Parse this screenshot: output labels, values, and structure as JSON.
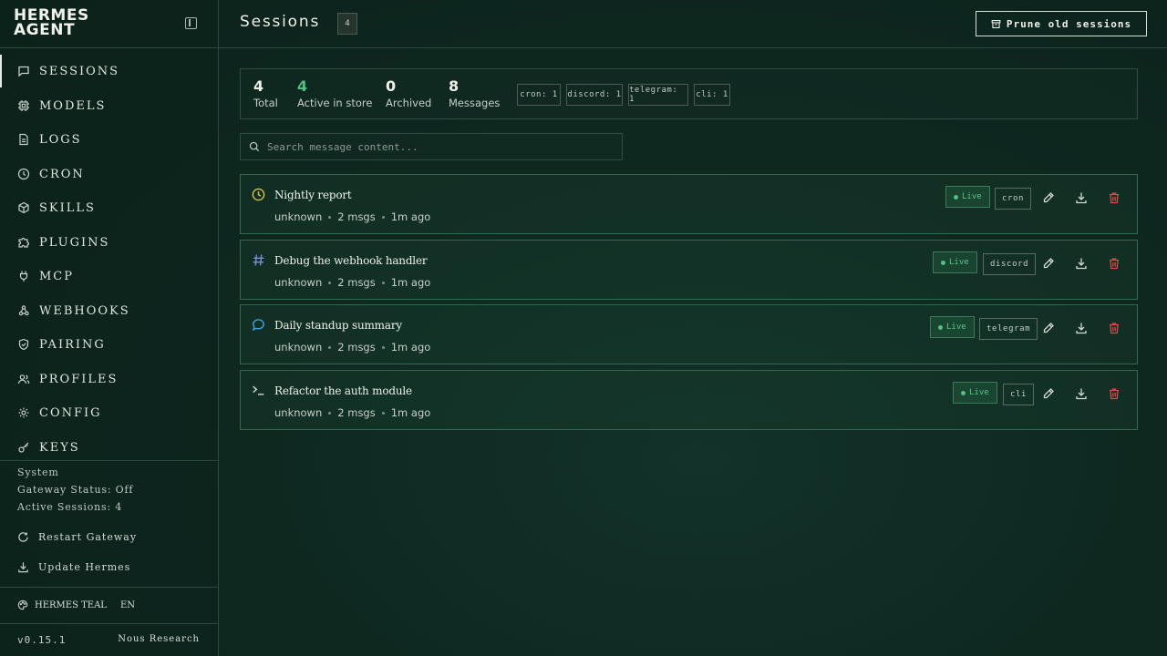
{
  "brand": {
    "line1": "HERMES",
    "line2": "AGENT"
  },
  "nav": [
    {
      "label": "SESSIONS",
      "icon": "chat-icon",
      "active": true
    },
    {
      "label": "MODELS",
      "icon": "cpu-icon"
    },
    {
      "label": "LOGS",
      "icon": "file-text-icon"
    },
    {
      "label": "CRON",
      "icon": "clock-icon"
    },
    {
      "label": "SKILLS",
      "icon": "package-icon"
    },
    {
      "label": "PLUGINS",
      "icon": "puzzle-icon"
    },
    {
      "label": "MCP",
      "icon": "plug-icon"
    },
    {
      "label": "WEBHOOKS",
      "icon": "webhook-icon"
    },
    {
      "label": "PAIRING",
      "icon": "shield-check-icon"
    },
    {
      "label": "PROFILES",
      "icon": "users-icon"
    },
    {
      "label": "CONFIG",
      "icon": "gear-icon"
    },
    {
      "label": "KEYS",
      "icon": "key-icon"
    }
  ],
  "system": {
    "heading": "System",
    "gateway_status": "Gateway Status: Off",
    "active_sessions": "Active Sessions: 4",
    "restart_label": "Restart Gateway",
    "update_label": "Update Hermes"
  },
  "theme": {
    "name": "HERMES TEAL",
    "lang": "EN"
  },
  "footer": {
    "version": "v0.15.1",
    "org": "Nous Research"
  },
  "header": {
    "title": "Sessions",
    "count": "4",
    "prune_label": "Prune old sessions"
  },
  "stats": [
    {
      "value": "4",
      "label": "Total",
      "accent": false
    },
    {
      "value": "4",
      "label": "Active in store",
      "accent": true
    },
    {
      "value": "0",
      "label": "Archived",
      "accent": false
    },
    {
      "value": "8",
      "label": "Messages",
      "accent": false
    }
  ],
  "sources": [
    "cron: 1",
    "discord: 1",
    "telegram: 1",
    "cli: 1"
  ],
  "search": {
    "placeholder": "Search message content..."
  },
  "sessions": [
    {
      "title": "Nightly report",
      "model": "unknown",
      "msgs": "2 msgs",
      "time": "1m ago",
      "status": "Live",
      "source": "cron",
      "icon": "clock-icon"
    },
    {
      "title": "Debug the webhook handler",
      "model": "unknown",
      "msgs": "2 msgs",
      "time": "1m ago",
      "status": "Live",
      "source": "discord",
      "icon": "hash-icon"
    },
    {
      "title": "Daily standup summary",
      "model": "unknown",
      "msgs": "2 msgs",
      "time": "1m ago",
      "status": "Live",
      "source": "telegram",
      "icon": "chat-bubble-icon"
    },
    {
      "title": "Refactor the auth module",
      "model": "unknown",
      "msgs": "2 msgs",
      "time": "1m ago",
      "status": "Live",
      "source": "cli",
      "icon": "terminal-icon"
    }
  ],
  "colors": {
    "accent_green": "#4fc182",
    "danger": "#e0454a",
    "cron_icon": "#e2c34a",
    "discord_icon": "#7f8fe0",
    "telegram_icon": "#3fa3e0"
  }
}
